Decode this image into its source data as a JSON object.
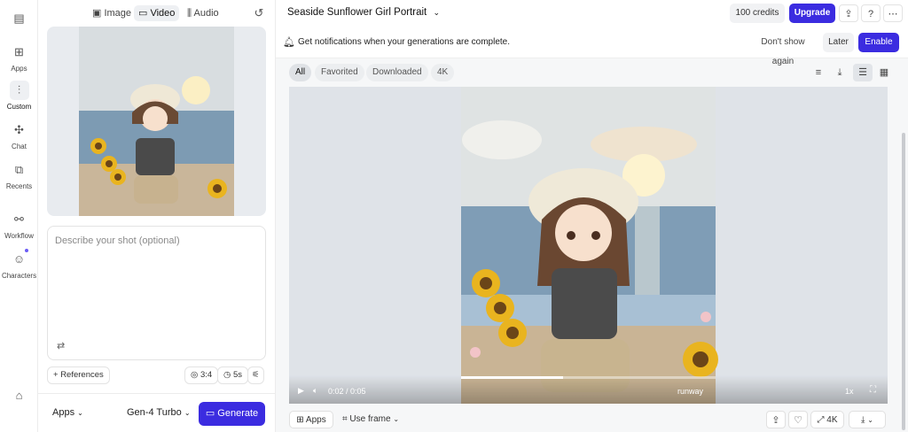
{
  "rail": {
    "items": [
      {
        "label": "Apps"
      },
      {
        "label": "Custom"
      },
      {
        "label": "Chat"
      },
      {
        "label": "Recents"
      },
      {
        "label": "Workflow"
      },
      {
        "label": "Characters"
      }
    ]
  },
  "panel": {
    "tabs": [
      "Image",
      "Video",
      "Audio"
    ],
    "prompt_placeholder": "Describe your shot (optional)",
    "references_label": "References",
    "ratio": "3:4",
    "duration": "5s",
    "apps_label": "Apps",
    "model": "Gen-4 Turbo",
    "generate_label": "Generate"
  },
  "header": {
    "title": "Seaside Sunflower Girl Portrait",
    "credits": "100 credits",
    "upgrade": "Upgrade"
  },
  "notification": {
    "text": "Get notifications when your generations are complete.",
    "dont_show": "Don't show again",
    "later": "Later",
    "enable": "Enable"
  },
  "filters": [
    "All",
    "Favorited",
    "Downloaded",
    "4K"
  ],
  "player": {
    "time": "0:02 / 0:05",
    "watermark": "runway",
    "speed": "1x",
    "progress": 0.4
  },
  "bottom": {
    "apps": "Apps",
    "use_frame": "Use frame",
    "quality": "4K"
  },
  "colors": {
    "accent": "#3b2ce0"
  }
}
